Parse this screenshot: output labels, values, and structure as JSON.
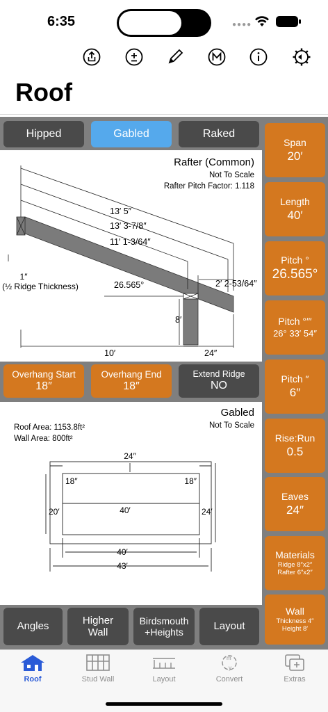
{
  "status": {
    "time": "6:35"
  },
  "page": {
    "title": "Roof"
  },
  "toolbar": {
    "icons": [
      "share-icon",
      "plus-minus-icon",
      "pencil-icon",
      "m-circle-icon",
      "info-icon",
      "settings-gear-icon"
    ]
  },
  "roof_type": {
    "options": [
      "Hipped",
      "Gabled",
      "Raked"
    ],
    "selected": "Gabled"
  },
  "rafter_diagram": {
    "title": "Rafter (Common)",
    "scale_note": "Not To Scale",
    "pitch_factor": "Rafter Pitch Factor: 1.118",
    "dim1": "13′ 5″",
    "dim2": "13′ 3-7/8″",
    "dim3": "11′ 1-3/64″",
    "dim_right": "2′ 2-53/64″",
    "angle": "26.565°",
    "ridge_line1": "1″",
    "ridge_line2": "(½ Ridge Thickness)",
    "height": "8′",
    "run": "10′",
    "overhang": "24″"
  },
  "overhang": {
    "start_label": "Overhang Start",
    "start_value": "18″",
    "end_label": "Overhang End",
    "end_value": "18″",
    "ridge_label": "Extend Ridge",
    "ridge_value": "NO"
  },
  "plan_diagram": {
    "title": "Gabled",
    "scale_note": "Not To Scale",
    "roof_area": "Roof Area: 1153.8ft²",
    "wall_area": "Wall Area: 800ft²",
    "top_overhang": "24″",
    "left_overhang": "18″",
    "right_overhang": "18″",
    "inner_length": "40′",
    "left_width": "20′",
    "right_width": "24′",
    "bottom_inner": "40′",
    "bottom_outer": "43′"
  },
  "side_buttons": [
    {
      "label": "Span",
      "value": "20′"
    },
    {
      "label": "Length",
      "value": "40′"
    },
    {
      "label": "Pitch °",
      "value": "26.565°"
    },
    {
      "label": "Pitch °′″",
      "value": "26° 33′ 54″"
    },
    {
      "label": "Pitch ″",
      "value": "6″"
    },
    {
      "label": "Rise:Run",
      "value": "0.5"
    },
    {
      "label": "Eaves",
      "value": "24″"
    },
    {
      "label": "Materials",
      "line1": "Ridge 8″x2″",
      "line2": "Rafter 6″x2″"
    },
    {
      "label": "Wall",
      "line1": "Thickness 4″",
      "line2": "Height 8′"
    }
  ],
  "bottom_buttons": {
    "angles": "Angles",
    "higher_wall_1": "Higher",
    "higher_wall_2": "Wall",
    "birdsmouth_1": "Birdsmouth",
    "birdsmouth_2": "+Heights",
    "layout": "Layout"
  },
  "tabs": [
    {
      "label": "Roof",
      "icon": "house-icon"
    },
    {
      "label": "Stud Wall",
      "icon": "stud-wall-icon"
    },
    {
      "label": "Layout",
      "icon": "layout-ruler-icon"
    },
    {
      "label": "Convert",
      "icon": "convert-icon"
    },
    {
      "label": "Extras",
      "icon": "extras-icon"
    }
  ],
  "colors": {
    "accent_orange": "#d4781f",
    "selected_blue": "#55a9ec",
    "dark_gray": "#4a4a4a",
    "active_tab": "#2a5bd7"
  }
}
